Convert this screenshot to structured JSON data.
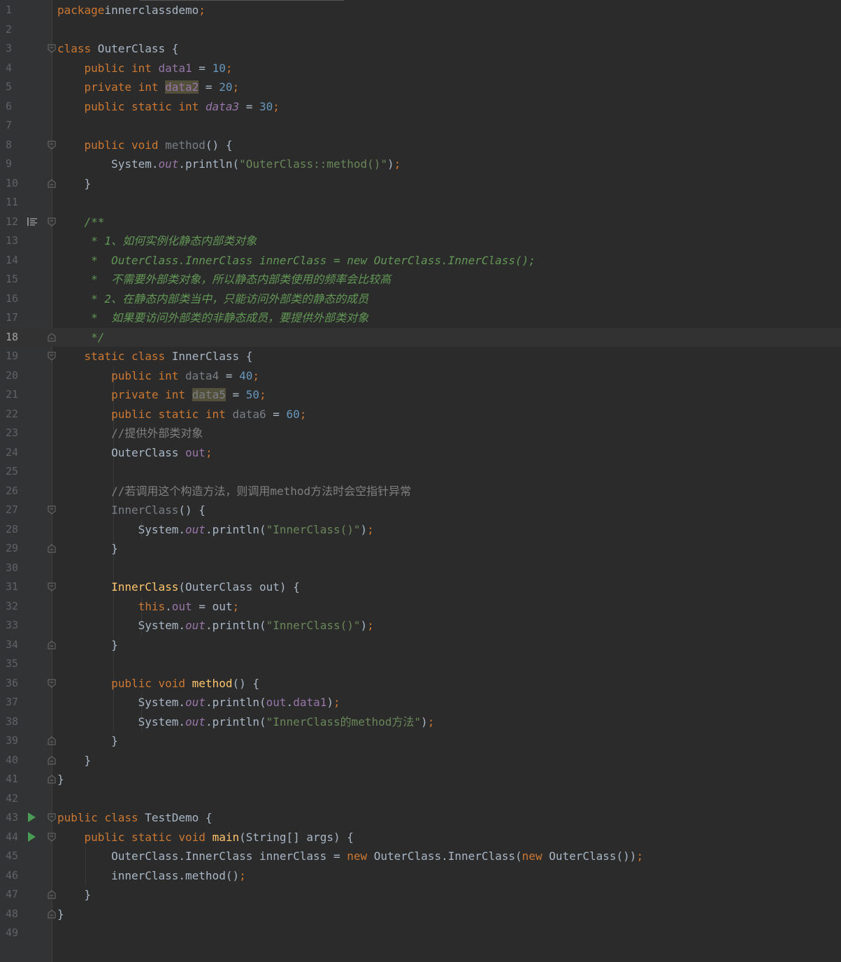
{
  "editor": {
    "current_line": "18",
    "lines": [
      {
        "n": "1",
        "segs": [
          [
            "kw",
            "package"
          ],
          [
            "",
            "innerclassdemo"
          ],
          [
            "kw",
            ";"
          ]
        ]
      },
      {
        "n": "2",
        "segs": []
      },
      {
        "n": "3",
        "segs": [
          [
            "kw",
            "class"
          ],
          [
            "",
            " OuterClass {"
          ]
        ]
      },
      {
        "n": "4",
        "segs": [
          [
            "",
            "    "
          ],
          [
            "kw",
            "public int "
          ],
          [
            "fld",
            "data1"
          ],
          [
            "",
            " = "
          ],
          [
            "num",
            "10"
          ],
          [
            "kw",
            ";"
          ]
        ]
      },
      {
        "n": "5",
        "segs": [
          [
            "",
            "    "
          ],
          [
            "kw",
            "private int "
          ],
          [
            "fld hl",
            "data2"
          ],
          [
            "",
            " = "
          ],
          [
            "num",
            "20"
          ],
          [
            "kw",
            ";"
          ]
        ]
      },
      {
        "n": "6",
        "segs": [
          [
            "",
            "    "
          ],
          [
            "kw",
            "public static int "
          ],
          [
            "sfi",
            "data3"
          ],
          [
            "",
            " = "
          ],
          [
            "num",
            "30"
          ],
          [
            "kw",
            ";"
          ]
        ]
      },
      {
        "n": "7",
        "segs": []
      },
      {
        "n": "8",
        "segs": [
          [
            "",
            "    "
          ],
          [
            "kw",
            "public void "
          ],
          [
            "unused",
            "method"
          ],
          [
            "",
            "() {"
          ]
        ]
      },
      {
        "n": "9",
        "segs": [
          [
            "",
            "        System."
          ],
          [
            "sfi",
            "out"
          ],
          [
            "",
            ".println("
          ],
          [
            "str",
            "\"OuterClass::method()\""
          ],
          [
            "",
            ")"
          ],
          [
            "kw",
            ";"
          ]
        ]
      },
      {
        "n": "10",
        "segs": [
          [
            "",
            "    }"
          ]
        ]
      },
      {
        "n": "11",
        "segs": []
      },
      {
        "n": "12",
        "segs": [
          [
            "doc",
            "    /**"
          ]
        ]
      },
      {
        "n": "13",
        "segs": [
          [
            "doc",
            "     * 1、如何实例化静态内部类对象"
          ]
        ]
      },
      {
        "n": "14",
        "segs": [
          [
            "doc",
            "     *  OuterClass.InnerClass innerClass = new OuterClass.InnerClass();"
          ]
        ]
      },
      {
        "n": "15",
        "segs": [
          [
            "doc",
            "     *  不需要外部类对象，所以静态内部类使用的频率会比较高"
          ]
        ]
      },
      {
        "n": "16",
        "segs": [
          [
            "doc",
            "     * 2、在静态内部类当中，只能访问外部类的静态的成员"
          ]
        ]
      },
      {
        "n": "17",
        "segs": [
          [
            "doc",
            "     *  如果要访问外部类的非静态成员，要提供外部类对象"
          ]
        ]
      },
      {
        "n": "18",
        "segs": [
          [
            "doc",
            "     */"
          ]
        ]
      },
      {
        "n": "19",
        "segs": [
          [
            "",
            "    "
          ],
          [
            "kw",
            "static class "
          ],
          [
            "",
            "InnerClass {"
          ]
        ]
      },
      {
        "n": "20",
        "segs": [
          [
            "",
            "        "
          ],
          [
            "kw",
            "public int "
          ],
          [
            "unused",
            "data4"
          ],
          [
            "",
            " = "
          ],
          [
            "num",
            "40"
          ],
          [
            "kw",
            ";"
          ]
        ]
      },
      {
        "n": "21",
        "segs": [
          [
            "",
            "        "
          ],
          [
            "kw",
            "private int "
          ],
          [
            "unused hl",
            "data5"
          ],
          [
            "",
            " = "
          ],
          [
            "num",
            "50"
          ],
          [
            "kw",
            ";"
          ]
        ]
      },
      {
        "n": "22",
        "segs": [
          [
            "",
            "        "
          ],
          [
            "kw",
            "public static int "
          ],
          [
            "unused",
            "data6"
          ],
          [
            "",
            " = "
          ],
          [
            "num",
            "60"
          ],
          [
            "kw",
            ";"
          ]
        ]
      },
      {
        "n": "23",
        "segs": [
          [
            "cmt",
            "        //提供外部类对象"
          ]
        ]
      },
      {
        "n": "24",
        "segs": [
          [
            "",
            "        OuterClass "
          ],
          [
            "fld",
            "out"
          ],
          [
            "kw",
            ";"
          ]
        ]
      },
      {
        "n": "25",
        "segs": []
      },
      {
        "n": "26",
        "segs": [
          [
            "cmt",
            "        //若调用这个构造方法，则调用method方法时会空指针异常"
          ]
        ]
      },
      {
        "n": "27",
        "segs": [
          [
            "",
            "        "
          ],
          [
            "unused",
            "InnerClass"
          ],
          [
            "",
            "() {"
          ]
        ]
      },
      {
        "n": "28",
        "segs": [
          [
            "",
            "            System."
          ],
          [
            "sfi",
            "out"
          ],
          [
            "",
            ".println("
          ],
          [
            "str",
            "\"InnerClass()\""
          ],
          [
            "",
            ")"
          ],
          [
            "kw",
            ";"
          ]
        ]
      },
      {
        "n": "29",
        "segs": [
          [
            "",
            "        }"
          ]
        ]
      },
      {
        "n": "30",
        "segs": []
      },
      {
        "n": "31",
        "segs": [
          [
            "",
            "        "
          ],
          [
            "fn",
            "InnerClass"
          ],
          [
            "",
            "(OuterClass out) {"
          ]
        ]
      },
      {
        "n": "32",
        "segs": [
          [
            "",
            "            "
          ],
          [
            "kw",
            "this"
          ],
          [
            "",
            "."
          ],
          [
            "fld",
            "out"
          ],
          [
            "",
            " = out"
          ],
          [
            "kw",
            ";"
          ]
        ]
      },
      {
        "n": "33",
        "segs": [
          [
            "",
            "            System."
          ],
          [
            "sfi",
            "out"
          ],
          [
            "",
            ".println("
          ],
          [
            "str",
            "\"InnerClass()\""
          ],
          [
            "",
            ")"
          ],
          [
            "kw",
            ";"
          ]
        ]
      },
      {
        "n": "34",
        "segs": [
          [
            "",
            "        }"
          ]
        ]
      },
      {
        "n": "35",
        "segs": []
      },
      {
        "n": "36",
        "segs": [
          [
            "",
            "        "
          ],
          [
            "kw",
            "public void "
          ],
          [
            "fn",
            "method"
          ],
          [
            "",
            "() {"
          ]
        ]
      },
      {
        "n": "37",
        "segs": [
          [
            "",
            "            System."
          ],
          [
            "sfi",
            "out"
          ],
          [
            "",
            ".println("
          ],
          [
            "fld",
            "out"
          ],
          [
            "",
            "."
          ],
          [
            "fld",
            "data1"
          ],
          [
            "",
            ")"
          ],
          [
            "kw",
            ";"
          ]
        ]
      },
      {
        "n": "38",
        "segs": [
          [
            "",
            "            System."
          ],
          [
            "sfi",
            "out"
          ],
          [
            "",
            ".println("
          ],
          [
            "str",
            "\"InnerClass的method方法\""
          ],
          [
            "",
            ")"
          ],
          [
            "kw",
            ";"
          ]
        ]
      },
      {
        "n": "39",
        "segs": [
          [
            "",
            "        }"
          ]
        ]
      },
      {
        "n": "40",
        "segs": [
          [
            "",
            "    }"
          ]
        ]
      },
      {
        "n": "41",
        "segs": [
          [
            "",
            "}"
          ]
        ]
      },
      {
        "n": "42",
        "segs": []
      },
      {
        "n": "43",
        "segs": [
          [
            "kw",
            "public class "
          ],
          [
            "",
            "TestDemo {"
          ]
        ]
      },
      {
        "n": "44",
        "segs": [
          [
            "",
            "    "
          ],
          [
            "kw",
            "public static void "
          ],
          [
            "fn",
            "main"
          ],
          [
            "",
            "(String[] args) {"
          ]
        ]
      },
      {
        "n": "45",
        "segs": [
          [
            "",
            "        OuterClass.InnerClass innerClass = "
          ],
          [
            "kw",
            "new "
          ],
          [
            "",
            "OuterClass.InnerClass("
          ],
          [
            "kw",
            "new "
          ],
          [
            "",
            "OuterClass())"
          ],
          [
            "kw",
            ";"
          ]
        ]
      },
      {
        "n": "46",
        "segs": [
          [
            "",
            "        innerClass.method()"
          ],
          [
            "kw",
            ";"
          ]
        ]
      },
      {
        "n": "47",
        "segs": [
          [
            "",
            "    }"
          ]
        ]
      },
      {
        "n": "48",
        "segs": [
          [
            "",
            "}"
          ]
        ]
      },
      {
        "n": "49",
        "segs": []
      }
    ],
    "run_icons": [
      "43",
      "44"
    ],
    "doc_icon_lines": [
      "12"
    ],
    "fold_open_lines": [
      "3",
      "8",
      "12",
      "19",
      "27",
      "31",
      "36",
      "43",
      "44"
    ],
    "fold_close_lines": [
      "10",
      "18",
      "29",
      "34",
      "39",
      "40",
      "41",
      "47",
      "48"
    ],
    "colors": {
      "background": "#2b2b2b",
      "gutter": "#313335",
      "keyword": "#cc7832",
      "number": "#6897bb",
      "string": "#6a8759",
      "field": "#9876aa",
      "function": "#ffc66d",
      "doc_comment": "#629755",
      "line_comment": "#808080",
      "run_icon": "#499c54"
    }
  }
}
